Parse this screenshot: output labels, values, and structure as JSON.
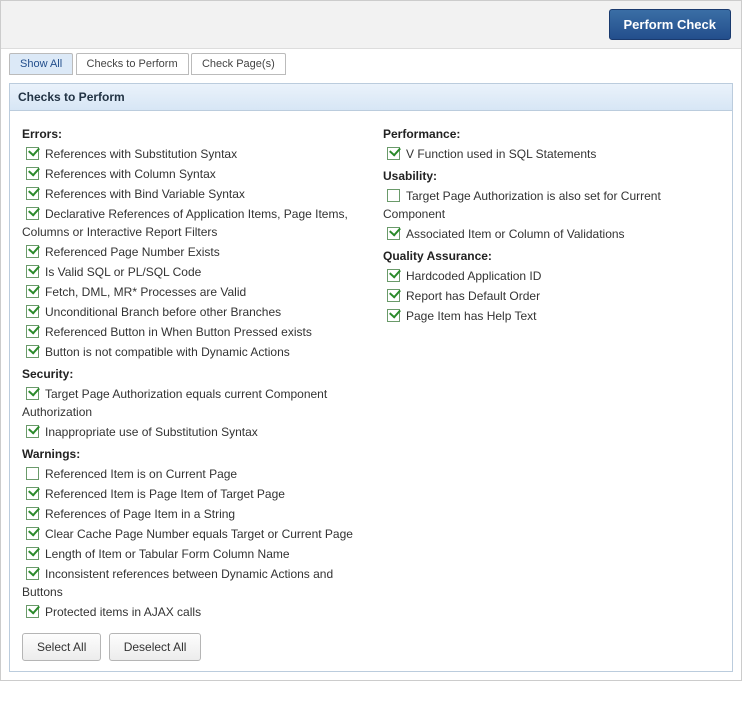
{
  "topbar": {
    "perform_label": "Perform Check"
  },
  "tabs": {
    "show_all": "Show All",
    "checks_to_perform": "Checks to Perform",
    "check_pages": "Check Page(s)"
  },
  "region": {
    "title": "Checks to Perform"
  },
  "left": [
    {
      "title": "Errors:",
      "items": [
        {
          "label": "References with Substitution Syntax",
          "checked": true
        },
        {
          "label": "References with Column Syntax",
          "checked": true
        },
        {
          "label": "References with Bind Variable Syntax",
          "checked": true
        },
        {
          "label": "Declarative References of Application Items, Page Items, Columns or Interactive Report Filters",
          "checked": true
        },
        {
          "label": "Referenced Page Number Exists",
          "checked": true
        },
        {
          "label": "Is Valid SQL or PL/SQL Code",
          "checked": true
        },
        {
          "label": "Fetch, DML, MR* Processes are Valid",
          "checked": true
        },
        {
          "label": "Unconditional Branch before other Branches",
          "checked": true
        },
        {
          "label": "Referenced Button in When Button Pressed exists",
          "checked": true
        },
        {
          "label": "Button is not compatible with Dynamic Actions",
          "checked": true
        }
      ]
    },
    {
      "title": "Security:",
      "items": [
        {
          "label": "Target Page Authorization equals current Component Authorization",
          "checked": true
        },
        {
          "label": "Inappropriate use of Substitution Syntax",
          "checked": true
        }
      ]
    },
    {
      "title": "Warnings:",
      "items": [
        {
          "label": "Referenced Item is on Current Page",
          "checked": false
        },
        {
          "label": "Referenced Item is Page Item of Target Page",
          "checked": true
        },
        {
          "label": "References of Page Item in a String",
          "checked": true
        },
        {
          "label": "Clear Cache Page Number equals Target or Current Page",
          "checked": true
        },
        {
          "label": "Length of Item or Tabular Form Column Name",
          "checked": true
        },
        {
          "label": "Inconsistent references between Dynamic Actions and Buttons",
          "checked": true
        },
        {
          "label": "Protected items in AJAX calls",
          "checked": true
        }
      ]
    }
  ],
  "right": [
    {
      "title": "Performance:",
      "items": [
        {
          "label": "V Function used in SQL Statements",
          "checked": true
        }
      ]
    },
    {
      "title": "Usability:",
      "items": [
        {
          "label": "Target Page Authorization is also set for Current Component",
          "checked": false
        },
        {
          "label": "Associated Item or Column of Validations",
          "checked": true
        }
      ]
    },
    {
      "title": "Quality Assurance:",
      "items": [
        {
          "label": "Hardcoded Application ID",
          "checked": true
        },
        {
          "label": "Report has Default Order",
          "checked": true
        },
        {
          "label": "Page Item has Help Text",
          "checked": true
        }
      ]
    }
  ],
  "buttons": {
    "select_all": "Select All",
    "deselect_all": "Deselect All"
  }
}
